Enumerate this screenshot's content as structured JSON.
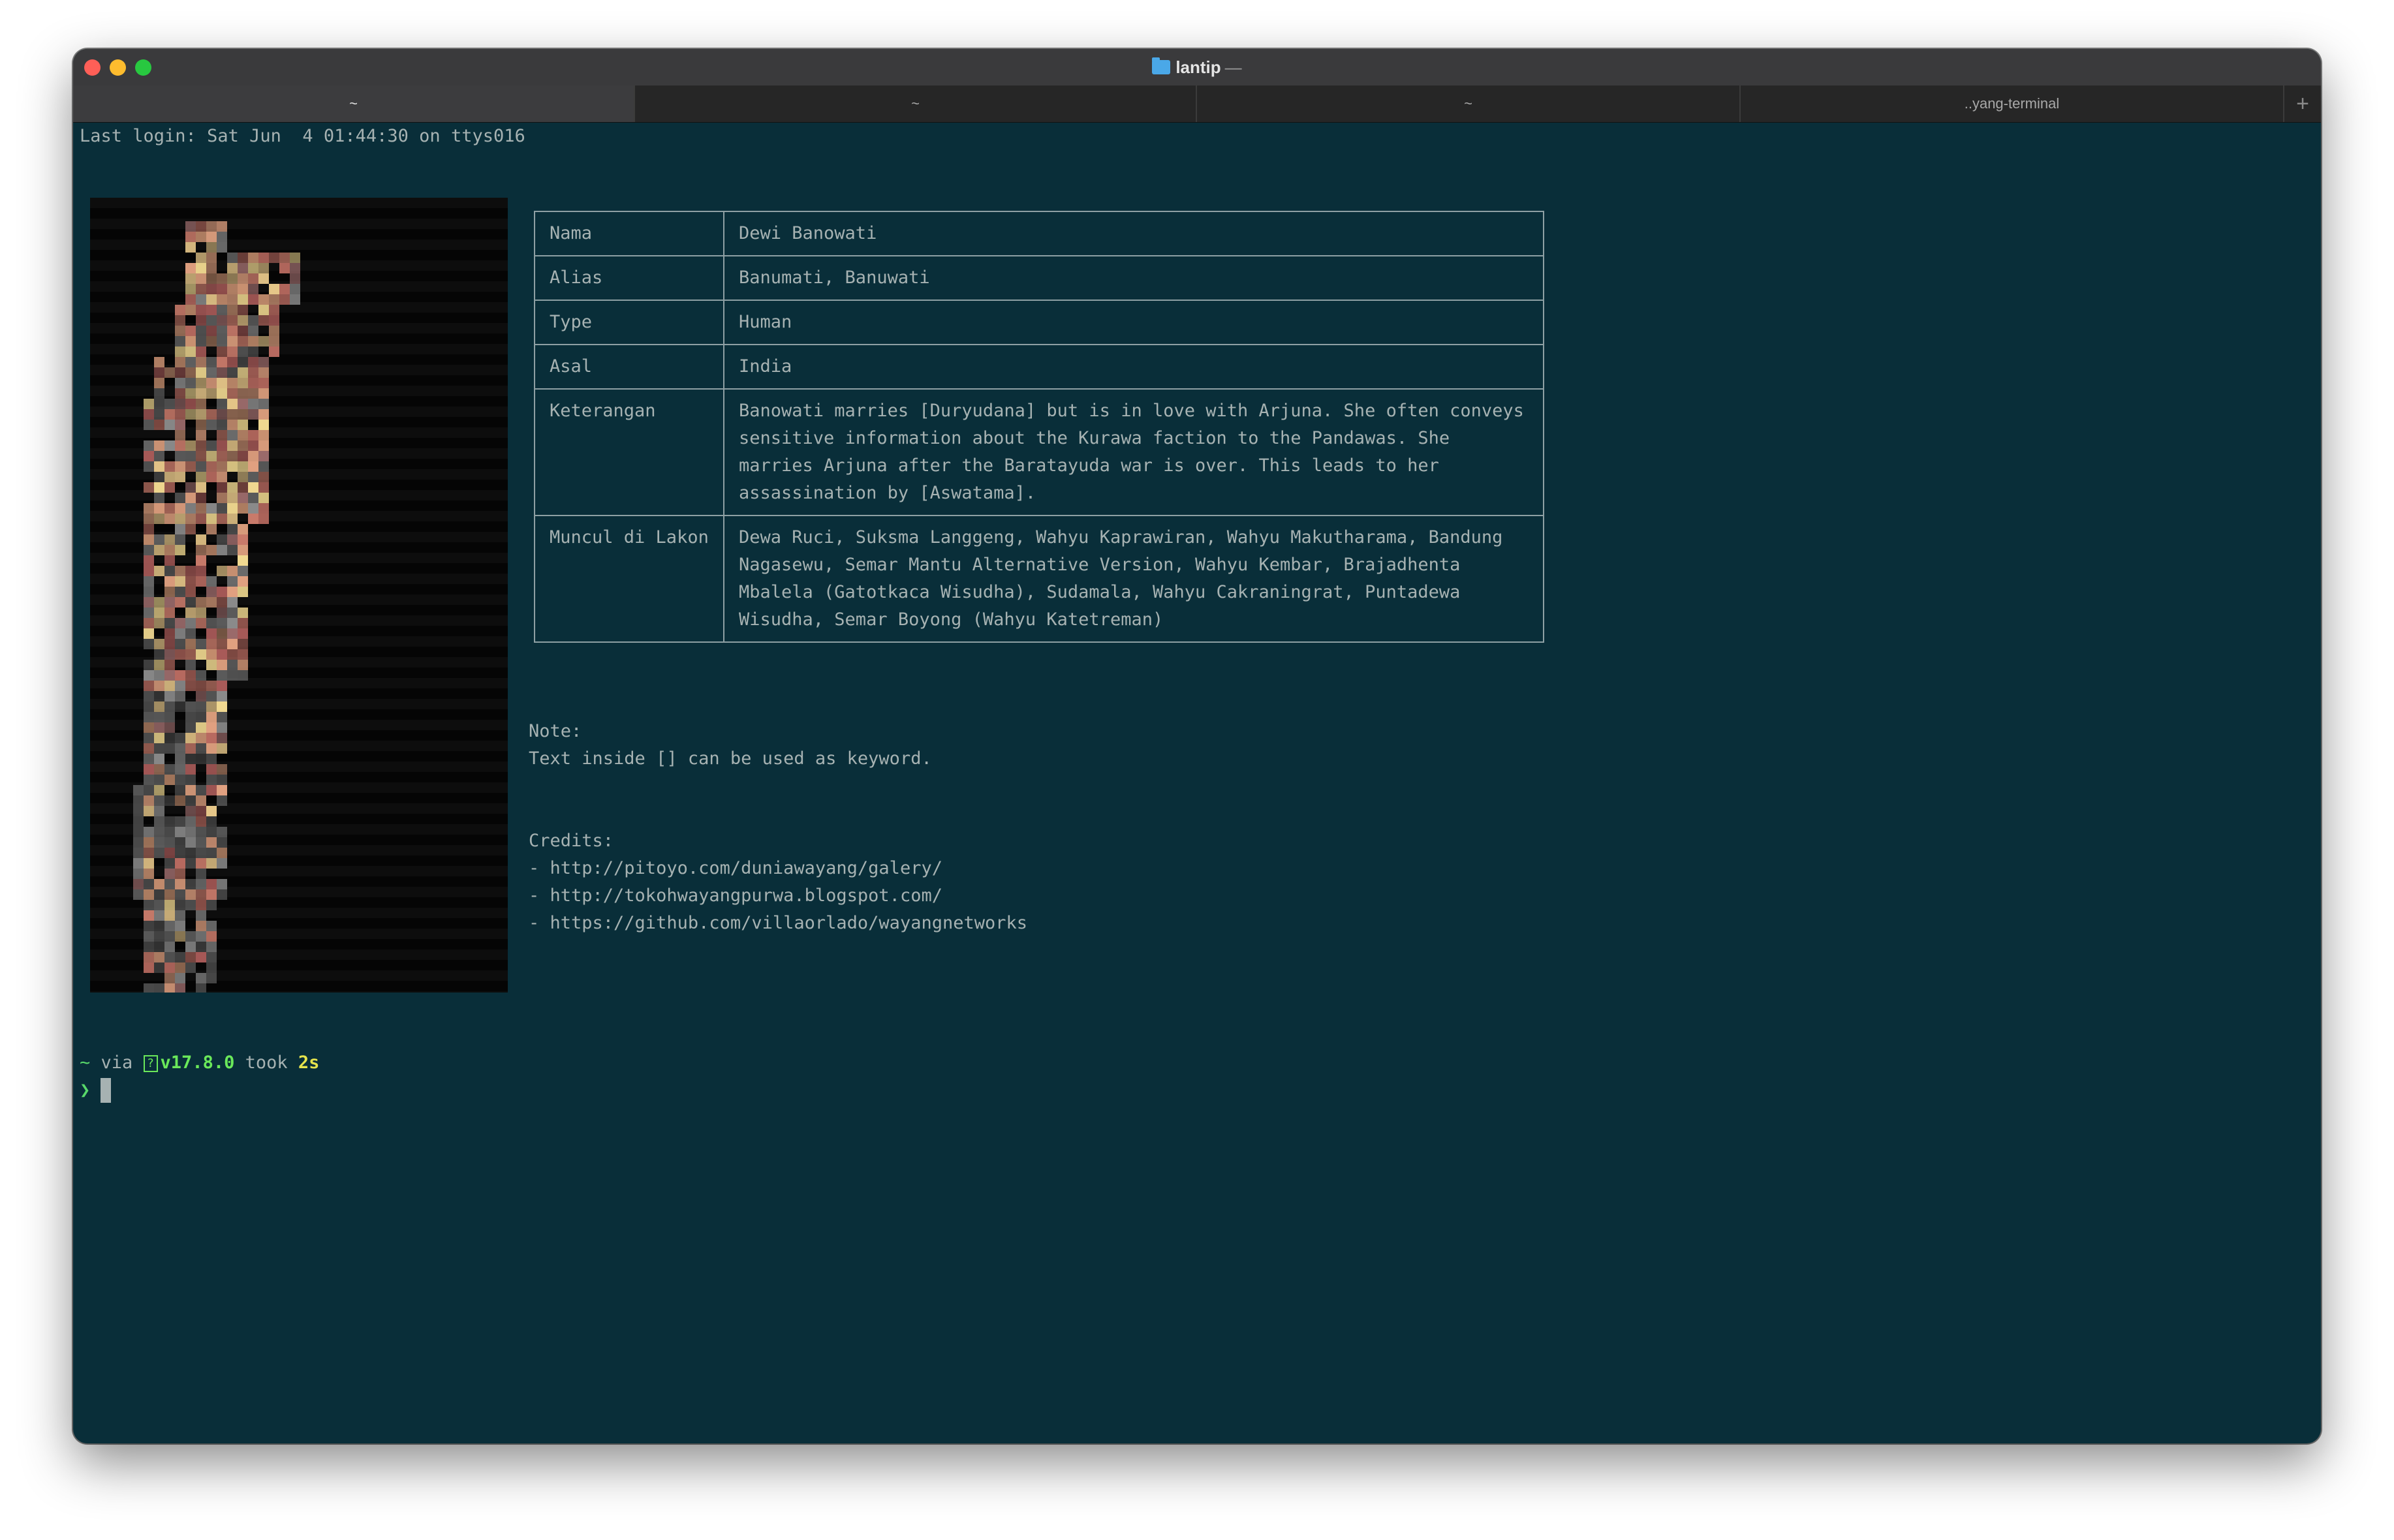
{
  "window": {
    "title": "lantip",
    "title_suffix": "—",
    "folder_icon": "folder-icon"
  },
  "tabs": [
    {
      "label": "~",
      "active": true
    },
    {
      "label": "~",
      "active": false
    },
    {
      "label": "~",
      "active": false
    },
    {
      "label": "..yang-terminal",
      "active": false
    }
  ],
  "tab_add_label": "+",
  "terminal": {
    "last_login": "Last login: Sat Jun  4 01:44:30 on ttys016",
    "table": [
      {
        "key": "Nama",
        "value": "Dewi Banowati"
      },
      {
        "key": "Alias",
        "value": "Banumati, Banuwati"
      },
      {
        "key": "Type",
        "value": "Human"
      },
      {
        "key": "Asal",
        "value": "India"
      },
      {
        "key": "Keterangan",
        "value": "Banowati marries [Duryudana] but is in love with Arjuna. She often conveys sensitive information about the Kurawa faction to the Pandawas. She marries Arjuna after the Baratayuda war is over. This leads to her assassination by [Aswatama]."
      },
      {
        "key": "Muncul di Lakon",
        "value": "Dewa Ruci, Suksma Langgeng, Wahyu Kaprawiran, Wahyu Makutharama, Bandung Nagasewu, Semar Mantu Alternative Version, Wahyu Kembar, Brajadhenta Mbalela (Gatotkaca Wisudha), Sudamala, Wahyu Cakraningrat, Puntadewa Wisudha, Semar Boyong (Wahyu Katetreman)"
      }
    ],
    "note_title": "Note:",
    "note_text": "Text inside [] can be used as keyword.",
    "credits_title": "Credits:",
    "credits": [
      "- http://pitoyo.com/duniawayang/galery/",
      "- http://tokohwayangpurwa.blogspot.com/",
      "- https://github.com/villaorlado/wayangnetworks"
    ],
    "prompt": {
      "dir": "~",
      "via": " via ",
      "node_icon": "node-icon",
      "version": "v17.8.0",
      "took": " took ",
      "duration": "2s",
      "caret": "❯"
    }
  },
  "colors": {
    "terminal_bg": "#092e39",
    "text": "#a6b2b2",
    "prompt_green": "#58d86a",
    "duration_yellow": "#e5e34c"
  }
}
